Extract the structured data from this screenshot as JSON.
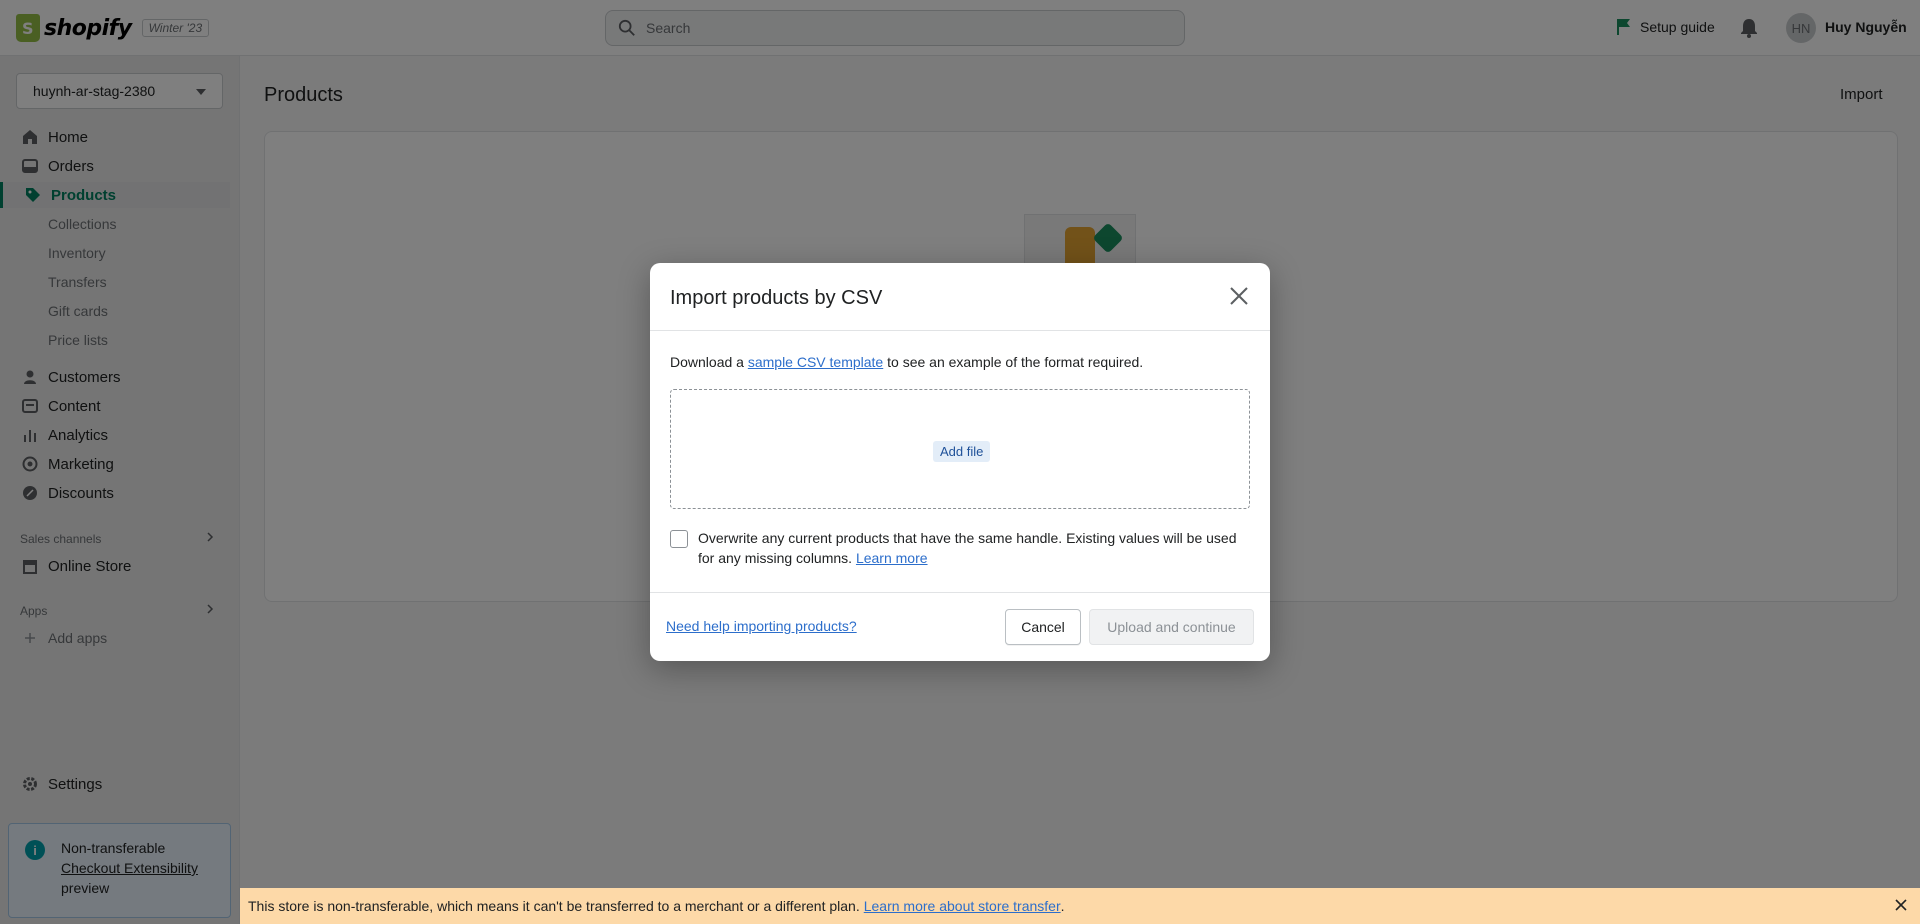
{
  "topbar": {
    "logo_text": "shopify",
    "edition_badge": "Winter '23",
    "search_placeholder": "Search",
    "setup_guide": "Setup guide",
    "avatar_initials": "HN",
    "user_name": "Huy Nguyễn"
  },
  "sidebar": {
    "store_name": "huynh-ar-stag-2380",
    "items": [
      {
        "label": "Home",
        "icon": "home-icon"
      },
      {
        "label": "Orders",
        "icon": "orders-icon"
      },
      {
        "label": "Products",
        "icon": "tag-icon",
        "active": true
      },
      {
        "label": "Collections"
      },
      {
        "label": "Inventory"
      },
      {
        "label": "Transfers"
      },
      {
        "label": "Gift cards"
      },
      {
        "label": "Price lists"
      },
      {
        "label": "Customers",
        "icon": "person-icon"
      },
      {
        "label": "Content",
        "icon": "content-icon"
      },
      {
        "label": "Analytics",
        "icon": "bar-chart-icon"
      },
      {
        "label": "Marketing",
        "icon": "target-icon"
      },
      {
        "label": "Discounts",
        "icon": "discount-icon"
      }
    ],
    "sales_channels_title": "Sales channels",
    "online_store": "Online Store",
    "apps_title": "Apps",
    "add_apps": "Add apps",
    "settings": "Settings",
    "notice": {
      "line1": "Non-transferable",
      "line2": "Checkout Extensibility",
      "line3": "preview"
    }
  },
  "main": {
    "page_title": "Products",
    "import_label": "Import"
  },
  "modal": {
    "title": "Import products by CSV",
    "desc_prefix": "Download a",
    "desc_link": "sample CSV template",
    "desc_suffix": "to see an example of the format required.",
    "add_file": "Add file",
    "overwrite_text": "Overwrite any current products that have the same handle. Existing values will be used for any missing columns.",
    "learn_more": "Learn more",
    "overwrite_checked": false,
    "help_link": "Need help importing products?",
    "cancel": "Cancel",
    "upload": "Upload and continue"
  },
  "banner": {
    "text": "This store is non-transferable, which means it can't be transferred to a merchant or a different plan.",
    "link": "Learn more about store transfer",
    "period": "."
  },
  "colors": {
    "accent": "#008060",
    "link": "#2c6ecb",
    "banner_bg": "#fdd9a8"
  }
}
